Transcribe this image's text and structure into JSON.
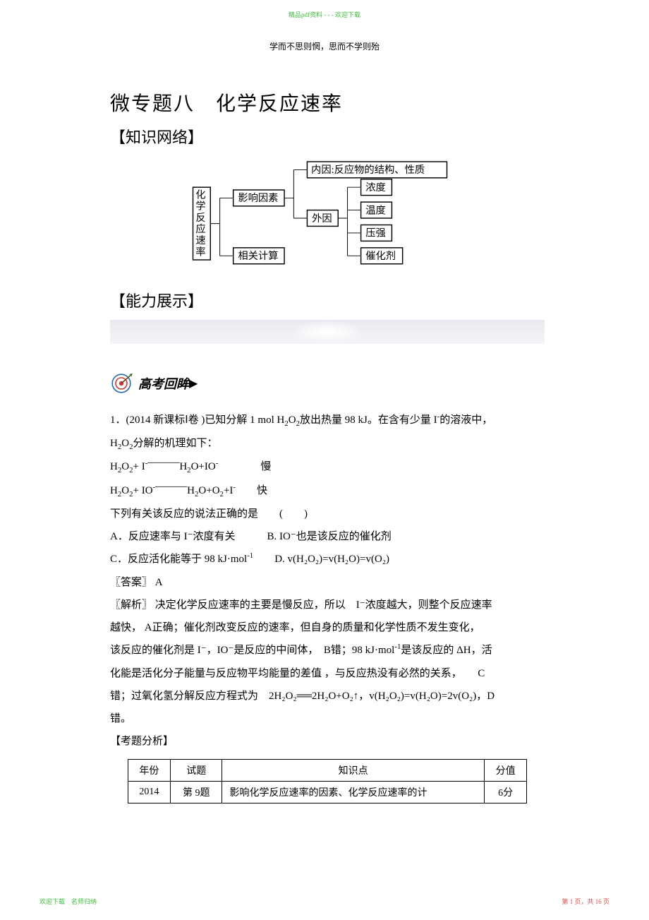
{
  "watermark_top": "精品pdf资料 - - - 欢迎下载",
  "header_quote": "学而不思则惘，思而不学则殆",
  "title": "微专题八　化学反应速率",
  "section_knowledge": "【知识网络】",
  "section_ability": "【能力展示】",
  "exam_review": "高考回眸",
  "diagram": {
    "root": "化学反应速率",
    "b1": "影响因素",
    "b2": "相关计算",
    "inner": "内因:反应物的结构、性质",
    "outer": "外因",
    "outer_items": [
      "浓度",
      "温度",
      "压强",
      "催化剂"
    ]
  },
  "question": {
    "intro_a": "1．(2014 新课标Ⅰ卷 )已知分解 1 mol H",
    "intro_b": "放出热量 98 kJ。在含有少量 I",
    "intro_c": "的溶液中，",
    "intro2_a": "H",
    "intro2_b": "分解的机理如下：",
    "mech1_a": "H",
    "mech1_b": "+ I",
    "mech1_arrow_top": "———",
    "mech1_c": "H",
    "mech1_d": "O+IO",
    "mech1_rate": "慢",
    "mech2_a": "H",
    "mech2_b": "+ IO",
    "mech2_arrow_top": "———",
    "mech2_c": "H",
    "mech2_d": "O+O",
    "mech2_e": "+I",
    "mech2_rate": "快",
    "stem": "下列有关该反应的说法正确的是　　(　　)",
    "optA": "A．反应速率与 I⁻浓度有关",
    "optB": "B. IO⁻也是该反应的催化剂",
    "optC_pre": "C．反应活化能等于 98 kJ·mol",
    "optD": "D. v(H₂O₂)=v(H₂O)=v(O₂)",
    "answer": "〖答案〗 A",
    "explain1": "〖解析〗 决定化学反应速率的主要是慢反应，所以　I⁻浓度越大，则整个反应速率",
    "explain2": "越快， A正确；催化剂改变反应的速率，但自身的质量和化学性质不发生变化，",
    "explain3_a": "该反应的催化剂是 I⁻，IO⁻是反应的中间体，　B错；98 kJ·mol",
    "explain3_b": "是该反应的 ΔH，活",
    "explain4": "化能是活化分子能量与反应物平均能量的差值 ，与反应热没有必然的关系，　　C",
    "explain5": "错；过氧化氢分解反应方程式为　2H₂O₂══2H₂O+O₂↑，v(H₂O₂)=v(H₂O)=2v(O₂)，D",
    "explain6": "错。"
  },
  "analysis_header": "【考题分析】",
  "table": {
    "headers": [
      "年份",
      "试题",
      "知识点",
      "分值"
    ],
    "row": [
      "2014",
      "第 9题",
      "影响化学反应速率的因素、化学反应速率的计",
      "6分"
    ]
  },
  "footer_left": "欢迎下载　名师归纳",
  "footer_right": "第 1 页，共 16 页"
}
